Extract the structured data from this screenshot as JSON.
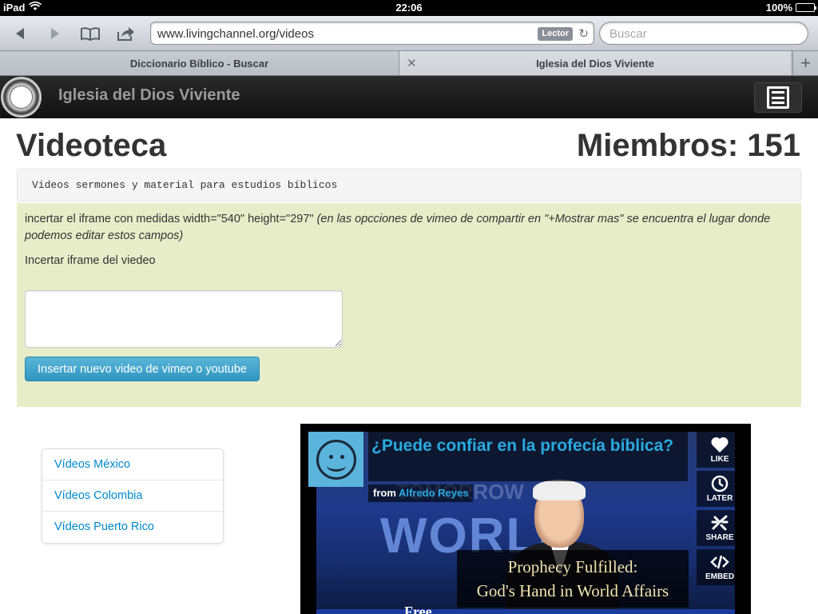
{
  "status_bar": {
    "device": "iPad",
    "time": "22:06",
    "battery": "100%",
    "battery_level": 1.0
  },
  "toolbar": {
    "url": "www.livingchannel.org/videos",
    "reader_label": "Lector",
    "search_placeholder": "Buscar"
  },
  "tabs": [
    {
      "label": "Diccionario Bíblico - Buscar"
    },
    {
      "label": "Iglesia del Dios Viviente"
    }
  ],
  "navbar": {
    "brand": "Iglesia del Dios Viviente"
  },
  "page": {
    "title": "Videoteca",
    "members": "Miembros: 151",
    "subheader": "Videos sermones y material para estudios bíblicos"
  },
  "form": {
    "instruction_plain": "incertar el iframe con medidas width=\"540\" height=\"297\" ",
    "instruction_italic": "(en las opcciones de vimeo de compartir en \"+Mostrar mas\" se encuentra el lugar donde podemos editar estos campos)",
    "label": "Incertar iframe del viedeo",
    "textarea_value": "",
    "submit_label": "Insertar nuevo video de vimeo o youtube"
  },
  "sidebar": {
    "items": [
      {
        "label": "Vídeos México"
      },
      {
        "label": "Vídeos Colombia"
      },
      {
        "label": "Vídeos Puerto Rico"
      }
    ]
  },
  "video": {
    "title": "¿Puede confiar en la profecía bíblica?",
    "from_label": "from",
    "author": "Alfredo Reyes",
    "frame_text_top": "TOMORROW",
    "frame_text_world": "WORLD",
    "caption_line1": "Prophecy Fulfilled:",
    "caption_line2": "God's Hand in World Affairs",
    "free_text": "Free",
    "controls": [
      {
        "label": "LIKE",
        "icon": "heart-icon"
      },
      {
        "label": "LATER",
        "icon": "clock-icon"
      },
      {
        "label": "SHARE",
        "icon": "share-icon"
      },
      {
        "label": "EMBED",
        "icon": "embed-icon"
      }
    ]
  },
  "colors": {
    "link": "#0088cc",
    "panel_bg": "#e8edc9",
    "button_blue": "#2f96c0",
    "vimeo_blue": "#28aae1"
  }
}
